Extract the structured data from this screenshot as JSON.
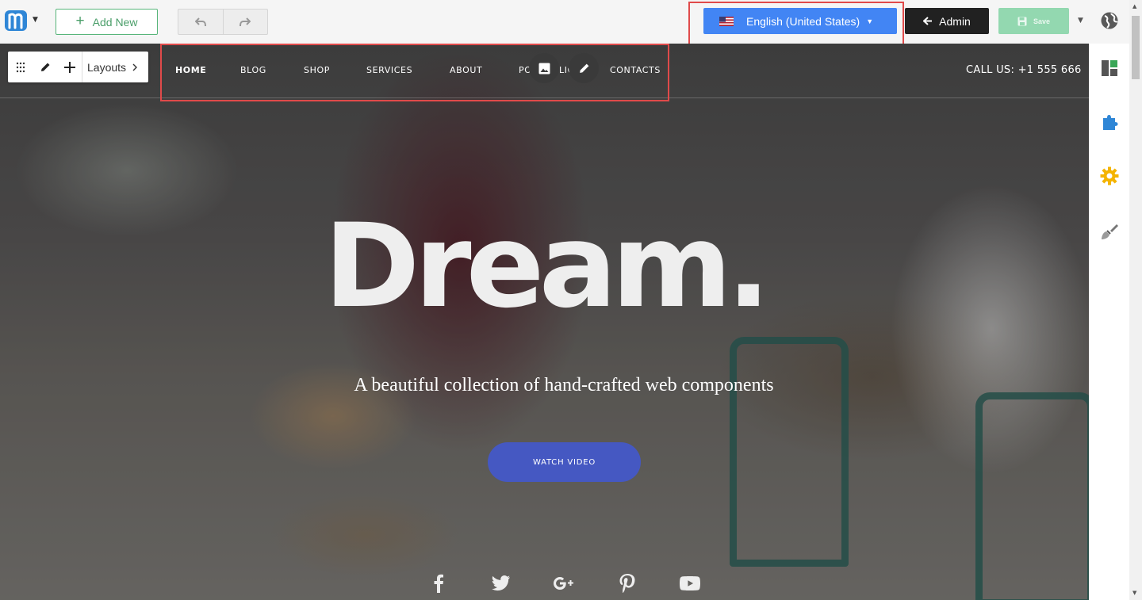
{
  "toolbar": {
    "add_new_label": "Add New",
    "language_label": "English (United States)",
    "admin_label": "Admin",
    "save_label": "Save"
  },
  "editor": {
    "layouts_label": "Layouts"
  },
  "site": {
    "nav": [
      {
        "label": "HOME",
        "active": true
      },
      {
        "label": "BLOG"
      },
      {
        "label": "SHOP"
      },
      {
        "label": "SERVICES"
      },
      {
        "label": "ABOUT"
      },
      {
        "label": "PO",
        "partial": true
      },
      {
        "label": "LIO",
        "partial": true
      },
      {
        "label": "CONTACTS"
      }
    ],
    "call_us": "CALL US: +1 555 666",
    "hero_title": "Dream.",
    "hero_subtitle": "A beautiful collection of hand-crafted web components",
    "cta_label": "WATCH VIDEO",
    "social_icons": [
      "facebook-icon",
      "twitter-icon",
      "google-plus-icon",
      "pinterest-icon",
      "youtube-icon"
    ]
  },
  "colors": {
    "language_button": "#4285f4",
    "admin_button": "#212121",
    "save_button": "#93d8b0",
    "add_new_border": "#58b57a",
    "cta_button": "#4558c2",
    "highlight": "#e04a4a"
  }
}
